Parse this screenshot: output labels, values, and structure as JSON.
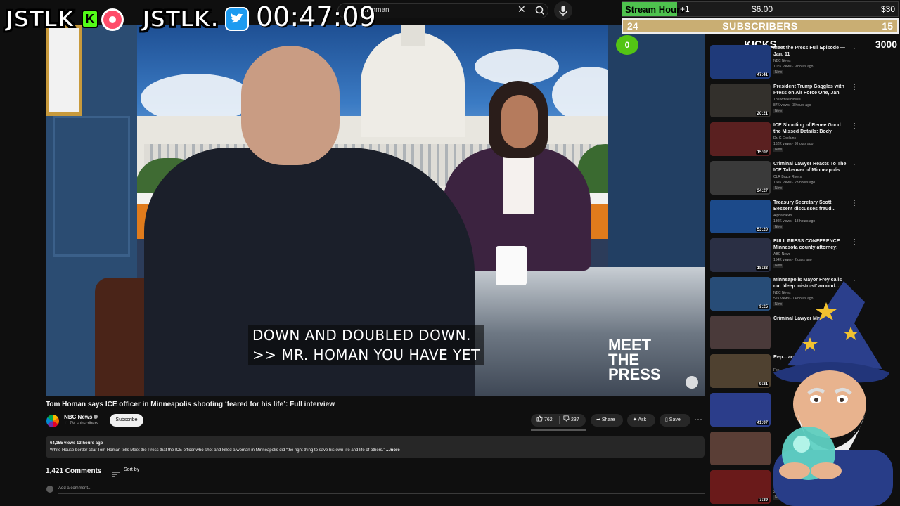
{
  "search": {
    "query": "...Homan"
  },
  "overlay": {
    "brand1": "JSTLK",
    "brand2": "JSTLK.",
    "kick_badge": "K",
    "timer": "00:47:09",
    "goal": {
      "label": "Stream Hours",
      "plus": "+1",
      "mid_value": "$6.00",
      "max_value": "$30",
      "progress": 0.2
    },
    "subs": {
      "current": "24",
      "label": "SUBSCRIBERS",
      "goal": "15"
    },
    "kicks": {
      "current": "0",
      "label": "KICKS",
      "goal": "3000"
    }
  },
  "video": {
    "captions": [
      "DOWN AND DOUBLED DOWN.",
      ">> MR. HOMAN YOU HAVE YET"
    ],
    "logo": "MEET THE PRESS",
    "title": "Tom Homan says ICE officer in Minneapolis shooting ‘feared for his life’: Full interview",
    "channel": "NBC News",
    "subscribers": "11.7M subscribers",
    "subscribe_label": "Subscribe",
    "likes": "762",
    "dislikes": "237",
    "share_label": "Share",
    "ask_label": "Ask",
    "save_label": "Save",
    "desc_meta": "64,155 views  13 hours ago",
    "desc_text": "White House border czar Tom Homan tells Meet the Press that the ICE officer who shot and killed a woman in Minneapolis did “the right thing to save his own life and life of others.”",
    "desc_more": " ...more",
    "comments_count": "1,421 Comments",
    "sort_label": "Sort by",
    "add_comment": "Add a comment..."
  },
  "sidebar": [
    {
      "title": "Meet the Press Full Episode — Jan. 11",
      "channel": "NBC News",
      "stats": "107K views · 9 hours ago",
      "new": "New",
      "duration": "47:41",
      "color": "#1f3a7a"
    },
    {
      "title": "President Trump Gaggles with Press on Air Force One, Jan. 1...",
      "channel": "The White House",
      "stats": "87K views · 3 hours ago",
      "new": "New",
      "duration": "20:21",
      "color": "#33302c"
    },
    {
      "title": "ICE Shooting of Renee Good the Missed Details: Body Languag...",
      "channel": "Dr. G Explains",
      "stats": "162K views · 9 hours ago",
      "new": "New",
      "duration": "15:02",
      "color": "#5a2020"
    },
    {
      "title": "Criminal Lawyer Reacts To The ICE Takeover of Minneapolis",
      "channel": "CLR Bruce Rivers",
      "stats": "160K views · 23 hours ago",
      "new": "New",
      "duration": "34:27",
      "color": "#3a3a3a"
    },
    {
      "title": "Treasury Secretary Scott Bessent discusses fraud...",
      "channel": "Alpha News",
      "stats": "130K views · 13 hours ago",
      "new": "New",
      "duration": "53:20",
      "color": "#1c4a8a"
    },
    {
      "title": "FULL PRESS CONFERENCE: Minnesota county attorney: 'W...",
      "channel": "ABC News",
      "stats": "154K views · 2 days ago",
      "new": "New",
      "duration": "18:23",
      "color": "#2a2f44"
    },
    {
      "title": "Minneapolis Mayor Frey calls out 'deep mistrust' around...",
      "channel": "NBC News",
      "stats": "52K views · 14 hours ago",
      "new": "New",
      "duration": "9:25",
      "color": "#274c77"
    },
    {
      "title": "Criminal Lawyer Minn...",
      "channel": "",
      "stats": "",
      "new": "",
      "duration": "",
      "color": "#4a3a3a"
    },
    {
      "title": "Rep... acce...",
      "channel": "Fox...",
      "stats": "",
      "new": "",
      "duration": "9:21",
      "color": "#4f4130"
    },
    {
      "title": "",
      "channel": "",
      "stats": "",
      "new": "",
      "duration": "41:07",
      "color": "#2b3d8a"
    },
    {
      "title": "",
      "channel": "",
      "stats": "",
      "new": "",
      "duration": "",
      "color": "#5a3e36"
    },
    {
      "title": "",
      "channel": "",
      "stats": "29K views · 2 hours ago",
      "new": "New",
      "duration": "7:39",
      "color": "#6a1a1a"
    }
  ]
}
